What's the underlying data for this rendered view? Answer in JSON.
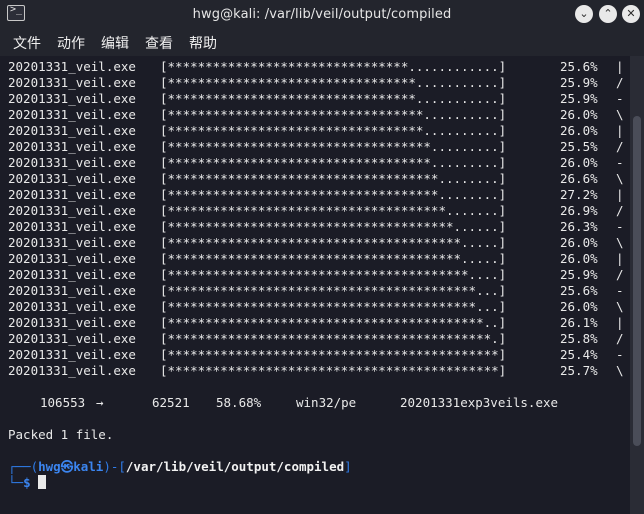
{
  "window": {
    "title": "hwg@kali: /var/lib/veil/output/compiled",
    "icon": "terminal-icon",
    "controls": {
      "minimize": "⌄",
      "maximize": "⌃",
      "close": "✕"
    }
  },
  "menu": [
    "文件",
    "动作",
    "编辑",
    "查看",
    "帮助"
  ],
  "progress_rows": [
    {
      "file": "20201331_veil.exe",
      "bar": "[********************************............]",
      "pct": "25.6%",
      "spin": "|"
    },
    {
      "file": "20201331_veil.exe",
      "bar": "[*********************************...........]",
      "pct": "25.9%",
      "spin": "/"
    },
    {
      "file": "20201331_veil.exe",
      "bar": "[*********************************...........]",
      "pct": "25.9%",
      "spin": "-"
    },
    {
      "file": "20201331_veil.exe",
      "bar": "[**********************************..........]",
      "pct": "26.0%",
      "spin": "\\"
    },
    {
      "file": "20201331_veil.exe",
      "bar": "[**********************************..........]",
      "pct": "26.0%",
      "spin": "|"
    },
    {
      "file": "20201331_veil.exe",
      "bar": "[***********************************.........]",
      "pct": "25.5%",
      "spin": "/"
    },
    {
      "file": "20201331_veil.exe",
      "bar": "[***********************************.........]",
      "pct": "26.0%",
      "spin": "-"
    },
    {
      "file": "20201331_veil.exe",
      "bar": "[************************************........]",
      "pct": "26.6%",
      "spin": "\\"
    },
    {
      "file": "20201331_veil.exe",
      "bar": "[************************************........]",
      "pct": "27.2%",
      "spin": "|"
    },
    {
      "file": "20201331_veil.exe",
      "bar": "[*************************************.......]",
      "pct": "26.9%",
      "spin": "/"
    },
    {
      "file": "20201331_veil.exe",
      "bar": "[**************************************......]",
      "pct": "26.3%",
      "spin": "-"
    },
    {
      "file": "20201331_veil.exe",
      "bar": "[***************************************.....]",
      "pct": "26.0%",
      "spin": "\\"
    },
    {
      "file": "20201331_veil.exe",
      "bar": "[***************************************.....]",
      "pct": "26.0%",
      "spin": "|"
    },
    {
      "file": "20201331_veil.exe",
      "bar": "[****************************************....]",
      "pct": "25.9%",
      "spin": "/"
    },
    {
      "file": "20201331_veil.exe",
      "bar": "[*****************************************...]",
      "pct": "25.6%",
      "spin": "-"
    },
    {
      "file": "20201331_veil.exe",
      "bar": "[*****************************************...]",
      "pct": "26.0%",
      "spin": "\\"
    },
    {
      "file": "20201331_veil.exe",
      "bar": "[******************************************..]",
      "pct": "26.1%",
      "spin": "|"
    },
    {
      "file": "20201331_veil.exe",
      "bar": "[*******************************************.]",
      "pct": "25.8%",
      "spin": "/"
    },
    {
      "file": "20201331_veil.exe",
      "bar": "[********************************************]",
      "pct": "25.4%",
      "spin": "-"
    },
    {
      "file": "20201331_veil.exe",
      "bar": "[********************************************]",
      "pct": "25.7%",
      "spin": "\\"
    }
  ],
  "summary": {
    "original_size": "106553",
    "arrow": "→",
    "packed_size": "62521",
    "ratio": "58.68%",
    "format": "win32/pe",
    "output_file": "20201331exp3veils.exe"
  },
  "packed_message": "Packed 1 file.",
  "prompt": {
    "corner_top": "┌──(",
    "user": "hwg",
    "at_symbol": "㉿",
    "host": "kali",
    "bracket_mid": ")-[",
    "path": "/var/lib/veil/output/compiled",
    "bracket_end": "]",
    "corner_bottom": "└─",
    "symbol": "$"
  },
  "colors": {
    "terminal_bg": "#1b1c26",
    "titlebar_bg": "#23252d",
    "prompt_blue": "#2f7ce8",
    "text": "#e9e9e9"
  }
}
